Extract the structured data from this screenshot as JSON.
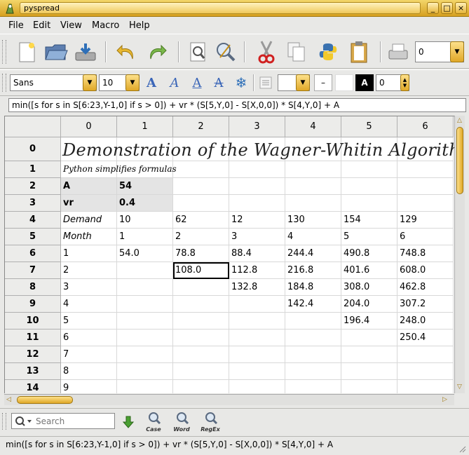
{
  "window": {
    "title": "pyspread",
    "buttons": [
      "_",
      "□",
      "×"
    ]
  },
  "menu": [
    {
      "label": "File"
    },
    {
      "label": "Edit"
    },
    {
      "label": "View"
    },
    {
      "label": "Macro"
    },
    {
      "label": "Help"
    }
  ],
  "toolbar": {
    "zoom_value": "0"
  },
  "format_toolbar": {
    "font": "Sans",
    "size": "10",
    "text_color_glyph": "A",
    "border_width": "0",
    "dash_label": "–"
  },
  "formula": "min([s for s in S[6:23,Y-1,0] if s > 0]) + vr * (S[5,Y,0] - S[X,0,0]) * S[4,Y,0] + A",
  "grid": {
    "col_headers": [
      "0",
      "1",
      "2",
      "3",
      "4",
      "5",
      "6"
    ],
    "row_headers": [
      "0",
      "1",
      "2",
      "3",
      "4",
      "5",
      "6",
      "7",
      "8",
      "9",
      "10",
      "11",
      "12",
      "13",
      "14"
    ],
    "title": "Demonstration of the Wagner-Whitin Algorithm",
    "subtitle": "Python simplifies formulas",
    "rows": [
      [
        "",
        "",
        "",
        "",
        "",
        "",
        ""
      ],
      [
        "",
        "",
        "",
        "",
        "",
        "",
        ""
      ],
      [
        "A",
        "54",
        "",
        "",
        "",
        "",
        ""
      ],
      [
        "vr",
        "0.4",
        "",
        "",
        "",
        "",
        ""
      ],
      [
        "Demand",
        "10",
        "62",
        "12",
        "130",
        "154",
        "129"
      ],
      [
        "Month",
        "1",
        "2",
        "3",
        "4",
        "5",
        "6"
      ],
      [
        "1",
        "54.0",
        "78.8",
        "88.4",
        "244.4",
        "490.8",
        "748.8"
      ],
      [
        "2",
        "",
        "108.0",
        "112.8",
        "216.8",
        "401.6",
        "608.0"
      ],
      [
        "3",
        "",
        "",
        "132.8",
        "184.8",
        "308.0",
        "462.8"
      ],
      [
        "4",
        "",
        "",
        "",
        "142.4",
        "204.0",
        "307.2"
      ],
      [
        "5",
        "",
        "",
        "",
        "",
        "196.4",
        "248.0"
      ],
      [
        "6",
        "",
        "",
        "",
        "",
        "",
        "250.4"
      ],
      [
        "7",
        "",
        "",
        "",
        "",
        "",
        ""
      ],
      [
        "8",
        "",
        "",
        "",
        "",
        "",
        ""
      ],
      [
        "9",
        "",
        "",
        "",
        "",
        "",
        ""
      ]
    ]
  },
  "search": {
    "placeholder": "Search",
    "options": [
      {
        "label": "Case"
      },
      {
        "label": "Word"
      },
      {
        "label": "RegEx"
      }
    ]
  },
  "status": "min([s for s in S[6:23,Y-1,0] if s > 0]) + vr * (S[5,Y,0] - S[X,0,0]) * S[4,Y,0] + A"
}
